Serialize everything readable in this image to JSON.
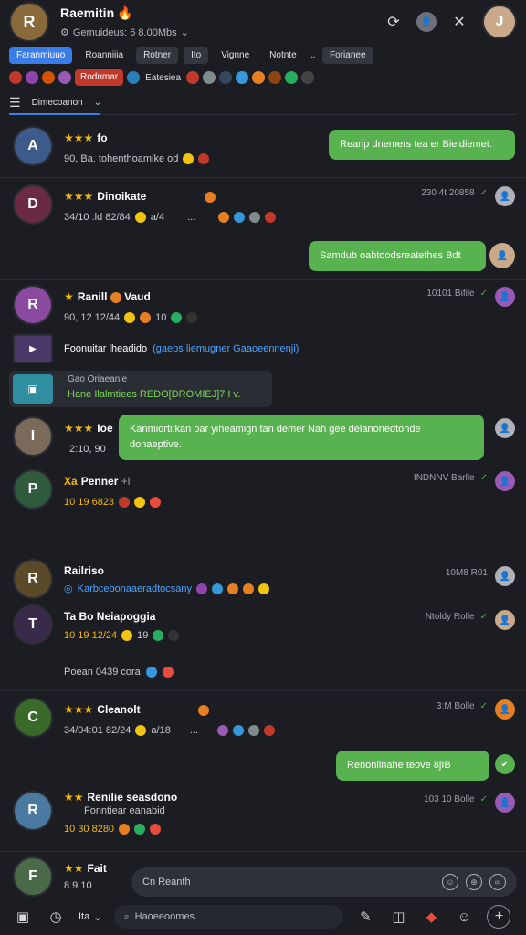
{
  "header": {
    "title": "Raemitin",
    "subtitle": "Gemuideus: 6 8.00Mbs",
    "avatar_initial": "R",
    "right_avatar_initial": "J"
  },
  "filters": [
    {
      "label": "Faranmiuuo",
      "active": true
    },
    {
      "label": "Roanniiia",
      "active": false,
      "plain": true
    },
    {
      "label": "Rotner",
      "active": false
    },
    {
      "label": "Ito",
      "active": false
    },
    {
      "label": "Vignne",
      "active": false,
      "plain": true
    },
    {
      "label": "Notnte",
      "active": false,
      "plain": true
    },
    {
      "label": "Forianee",
      "active": false
    }
  ],
  "tags": {
    "red_tag": "Rodnmar",
    "tag_text": "Eatesiea"
  },
  "tab": {
    "label": "Dimecoanon"
  },
  "messages": [
    {
      "name": "fo",
      "stars": "★★★",
      "meta": "90, Ba. tohenthoamike od",
      "avatar": "A",
      "avatar_color": "#3c5a8a",
      "bubble": "Rearip dnemers tea er Bieidiemet."
    },
    {
      "name": "Dinoikate",
      "stars": "★★★",
      "meta": "34/10 :ld 82/84",
      "meta2": "a/4",
      "time": "230 4t 20858",
      "avatar": "D",
      "avatar_color": "#6b2a44"
    },
    {
      "bubble": "Samdub oabtoodsreatethes Bdt"
    },
    {
      "name": "Ranill",
      "name2": "Vaud",
      "stars": "★",
      "meta": "90, 12 12/44",
      "meta2": "10",
      "time": "10101 Bifile",
      "avatar": "R",
      "avatar_color": "#8a4aa0"
    },
    {
      "link_plain": "Foonuitar lheadido",
      "link": "(gaebs liemugner Gaaoeennenji)"
    },
    {
      "card_line1": "Gao Oriaeanie",
      "card_line2": "Hane Ilalmtiees REDO[DROMIEJ]7 I  v."
    },
    {
      "name": "Ioe",
      "stars": "★★★",
      "meta": "2:10, 90",
      "avatar": "I",
      "avatar_color": "#7a6a5a",
      "bubble": "Kanmiorti:kan bar yiheamign tan demer Nah gee delanonedtonde donaeptive."
    },
    {
      "name": "Penner",
      "name_prefix": "Xa",
      "name_suffix": "+l",
      "meta": "10 19 6823",
      "time": "INDNNV Barlle",
      "avatar": "P",
      "avatar_color": "#2f5a3c"
    },
    {
      "name": "Railriso",
      "meta": "Karbcebonaaeradtocsany",
      "time": "10M8 R01",
      "avatar": "R",
      "avatar_color": "#5a4a2a",
      "meta_blue": true
    },
    {
      "name": "Ta Bo Neiapoggia",
      "meta": "10 19 12/24",
      "meta2": "19",
      "time": "Ntoldy Rolle",
      "avatar": "T",
      "avatar_color": "#3a2a4a"
    },
    {
      "sub": "Poean 0439 cora"
    },
    {
      "name": "Cleanolt",
      "stars": "★★★",
      "meta": "34/04:01 82/24",
      "meta2": "a/18",
      "time": "3:M Bolle",
      "avatar": "C",
      "avatar_color": "#3a6a2a"
    },
    {
      "bubble": "Renonlinahe teove 8jIB"
    },
    {
      "name": "Renilie seasdono",
      "stars": "★★",
      "meta": "Fonntiear eanabid",
      "meta2": "10 30 8280",
      "time": "103 10 Bolle",
      "avatar": "R",
      "avatar_color": "#4a7aa0"
    },
    {
      "name": "Fait",
      "stars": "★★",
      "meta": "8 9 10",
      "avatar": "F",
      "avatar_color": "#4a6a4a"
    }
  ],
  "composer": {
    "placeholder": "Cn Reanth"
  },
  "bottom": {
    "tab_label": "Ita",
    "search_placeholder": "Haoeeoomes."
  }
}
